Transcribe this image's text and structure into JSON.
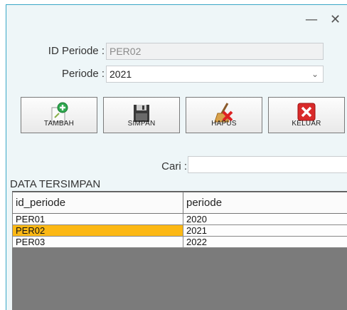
{
  "window": {
    "minimize_glyph": "—",
    "close_glyph": "✕"
  },
  "form": {
    "id_label": "ID Periode :",
    "id_value": "PER02",
    "periode_label": "Periode :",
    "periode_value": "2021",
    "search_label": "Cari :",
    "search_value": ""
  },
  "toolbar": {
    "add_label": "TAMBAH",
    "save_label": "SIMPAN",
    "delete_label": "HAPUS",
    "exit_label": "KELUAR"
  },
  "icons": {
    "add": "add-document-icon",
    "save": "floppy-disk-icon",
    "delete": "broom-delete-icon",
    "exit": "red-x-icon"
  },
  "colors": {
    "selected_row": "#fcb814",
    "accent": "#3aa7c7"
  },
  "table": {
    "title": "DATA TERSIMPAN",
    "columns": [
      "id_periode",
      "periode"
    ],
    "rows": [
      {
        "id_periode": "PER01",
        "periode": "2020"
      },
      {
        "id_periode": "PER02",
        "periode": "2021"
      },
      {
        "id_periode": "PER03",
        "periode": "2022"
      }
    ]
  }
}
